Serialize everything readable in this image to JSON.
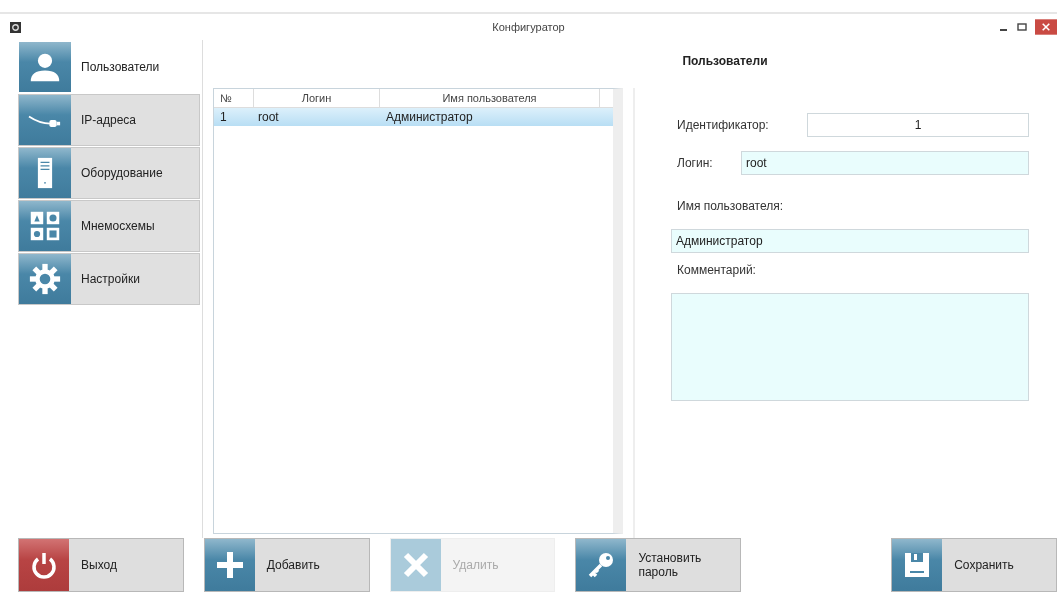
{
  "window": {
    "title": "Конфигуратор"
  },
  "sidebar": {
    "items": [
      {
        "label": "Пользователи",
        "selected": true
      },
      {
        "label": "IP-адреса",
        "selected": false
      },
      {
        "label": "Оборудование",
        "selected": false
      },
      {
        "label": "Мнемосхемы",
        "selected": false
      },
      {
        "label": "Настройки",
        "selected": false
      }
    ]
  },
  "section_title": "Пользователи",
  "table": {
    "columns": [
      "№",
      "Логин",
      "Имя пользователя"
    ],
    "rows": [
      {
        "cells": [
          "1",
          "root",
          "Администратор"
        ],
        "selected": true
      }
    ]
  },
  "form": {
    "id_label": "Идентификатор:",
    "id_value": "1",
    "login_label": "Логин:",
    "login_value": "root",
    "name_label": "Имя пользователя:",
    "name_value": "Администратор",
    "comment_label": "Комментарий:"
  },
  "exit_button": {
    "label": "Выход"
  },
  "buttons": [
    {
      "label": "Добавить",
      "disabled": false
    },
    {
      "label": "Удалить",
      "disabled": true
    },
    {
      "label": "Установить пароль",
      "disabled": false
    },
    {
      "label": "Сохранить",
      "disabled": false
    }
  ]
}
